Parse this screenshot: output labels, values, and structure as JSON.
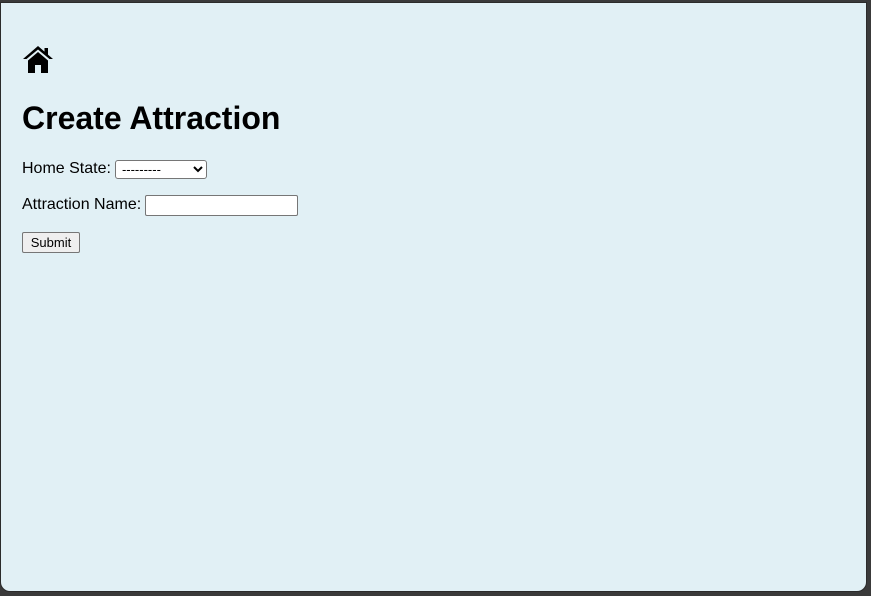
{
  "nav": {
    "home_icon": "home-icon"
  },
  "page": {
    "title": "Create Attraction"
  },
  "form": {
    "home_state_label": "Home State:",
    "home_state_selected": "---------",
    "attraction_name_label": "Attraction Name:",
    "attraction_name_value": "",
    "submit_label": "Submit"
  },
  "colors": {
    "background": "#e1f0f5"
  }
}
